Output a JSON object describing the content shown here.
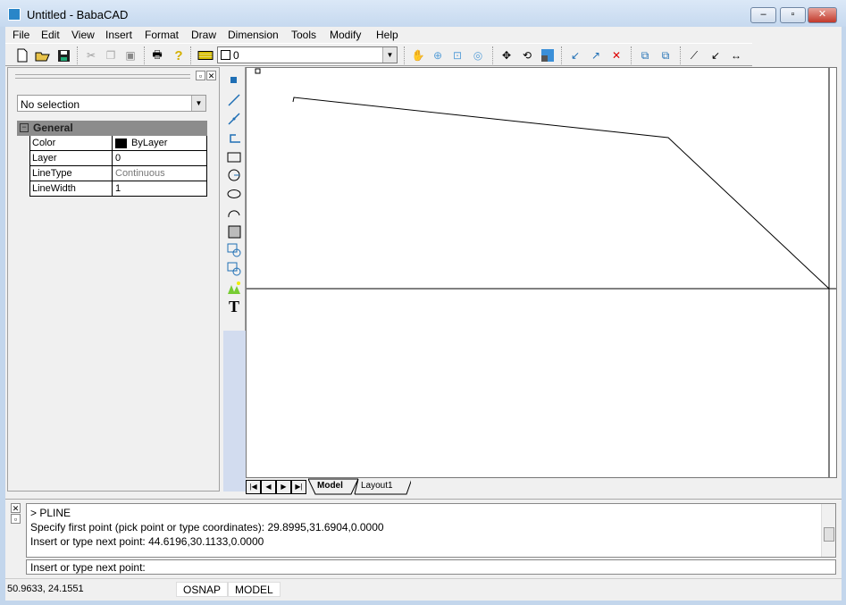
{
  "window": {
    "title": "Untitled - BabaCAD",
    "min": "–",
    "max": "▫",
    "close": "✕"
  },
  "menu": [
    "File",
    "Edit",
    "View",
    "Insert",
    "Format",
    "Draw",
    "Dimension",
    "Tools",
    "Modify",
    "Help"
  ],
  "layer": {
    "value": "0"
  },
  "properties": {
    "selection": "No selection",
    "group": "General",
    "group_toggle": "−",
    "rows": [
      {
        "key": "Color",
        "value": "ByLayer"
      },
      {
        "key": "Layer",
        "value": "0"
      },
      {
        "key": "LineType",
        "value": "Continuous"
      },
      {
        "key": "LineWidth",
        "value": "1"
      }
    ]
  },
  "tabs": {
    "model": "Model",
    "layout": "Layout1",
    "nav": [
      "|◀",
      "◀",
      "▶",
      "▶|"
    ]
  },
  "command": {
    "history": [
      "> PLINE",
      "Specify first point (pick point or type coordinates): 29.8995,31.6904,0.0000",
      "Insert or type next point: 44.6196,30.1133,0.0000"
    ],
    "prompt": "Insert or type next point:"
  },
  "status": {
    "coords": "50.9633, 24.1551",
    "osnap": "OSNAP",
    "model": "MODEL"
  },
  "colors": {
    "accent": "#1f6fb5",
    "color_swatch": "#000000"
  }
}
